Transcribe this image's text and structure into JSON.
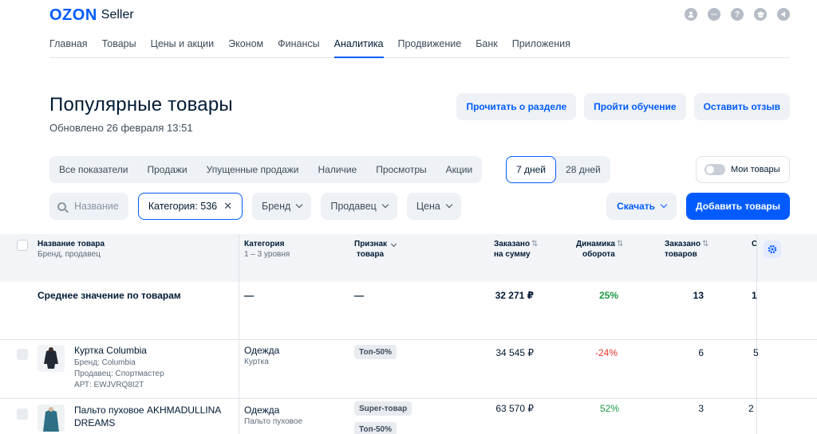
{
  "header": {
    "logo_brand": "OZON",
    "logo_product": "Seller",
    "icons": [
      "user-icon",
      "chat-icon",
      "help-icon",
      "education-icon",
      "notifications-icon"
    ]
  },
  "nav": {
    "items": [
      "Главная",
      "Товары",
      "Цены и акции",
      "Эконом",
      "Финансы",
      "Аналитика",
      "Продвижение",
      "Банк",
      "Приложения"
    ],
    "active": "Аналитика"
  },
  "page": {
    "title": "Популярные товары",
    "updated": "Обновлено 26 февраля 13:51",
    "buttons": {
      "read_section": "Прочитать о разделе",
      "training": "Пройти обучение",
      "feedback": "Оставить отзыв"
    }
  },
  "tabs": {
    "metrics": [
      "Все показатели",
      "Продажи",
      "Упущенные продажи",
      "Наличие",
      "Просмотры",
      "Акции"
    ],
    "periods": [
      "7 дней",
      "28 дней"
    ],
    "active_period": "7 дней"
  },
  "my_products_toggle": {
    "label": "Мои товары",
    "on": false
  },
  "filters": {
    "search_placeholder": "Название",
    "category": "Категория: 536",
    "brand": "Бренд",
    "seller": "Продавец",
    "price": "Цена",
    "download": "Скачать",
    "add_products": "Добавить товары"
  },
  "table": {
    "columns": {
      "name": {
        "title": "Название товара",
        "sub": "Бренд, продавец"
      },
      "category": {
        "title": "Категория",
        "sub": "1 – 3 уровня"
      },
      "feature": {
        "title": "Признак",
        "title2": "товара"
      },
      "ordered_sum": {
        "title": "Заказано",
        "title2": "на сумму"
      },
      "dynamics": {
        "title": "Динамика",
        "title2": "оборота"
      },
      "ordered_qty": {
        "title": "Заказано",
        "title2": "товаров"
      },
      "next_col_partial": "С"
    },
    "average": {
      "label": "Среднее значение по товарам",
      "category": "—",
      "feature": "—",
      "ordered_sum": "32 271 ₽",
      "dynamics": "25%",
      "ordered_qty": "13",
      "next_partial": "1"
    },
    "rows": [
      {
        "name": "Куртка Columbia",
        "brand": "Бренд: Columbia",
        "seller": "Продавец: Спортмастер",
        "sku": "АРТ: EWJVRQ8I2T",
        "category": "Одежда",
        "category_sub": "Куртка",
        "tags": [
          "Топ-50%"
        ],
        "ordered_sum": "34 545 ₽",
        "dynamics": "-24%",
        "dynamics_status": "negative",
        "ordered_qty": "6",
        "next_partial": "5"
      },
      {
        "name": "Пальто пуховое AKHMADULLINA",
        "name2": "DREAMS",
        "category": "Одежда",
        "category_sub": "Пальто пуховое",
        "tags": [
          "Super-товар",
          "Топ-50%"
        ],
        "ordered_sum": "63 570 ₽",
        "dynamics": "52%",
        "dynamics_status": "positive",
        "ordered_qty": "3",
        "next_partial": "2"
      }
    ]
  },
  "colors": {
    "accent": "#005bff",
    "positive": "#1a9944",
    "negative": "#e8322d",
    "surface": "#eef1f5"
  }
}
